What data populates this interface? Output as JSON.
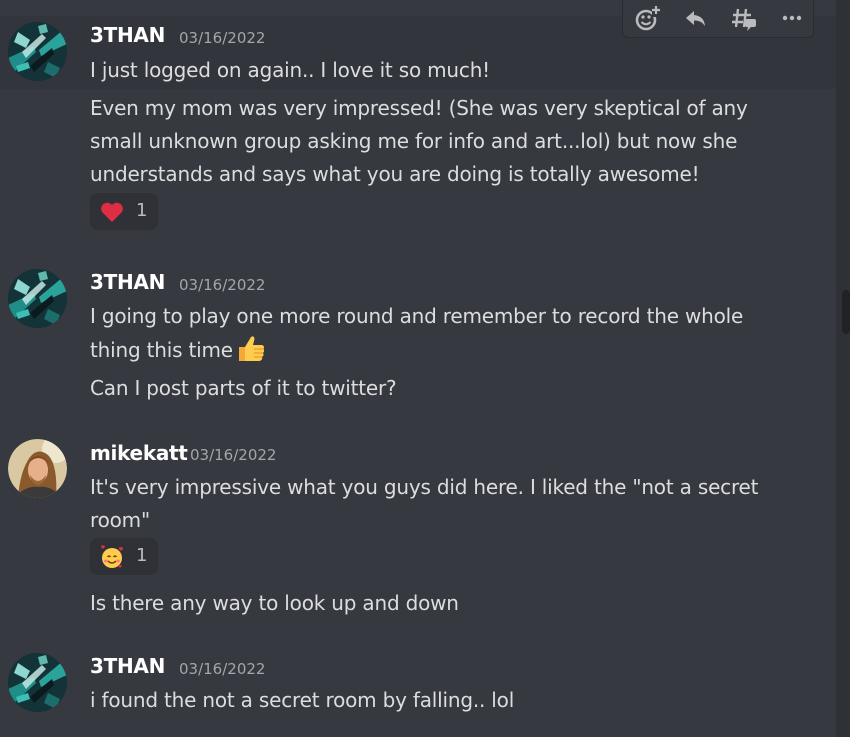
{
  "toolbar": {
    "icons": [
      "add-reaction-icon",
      "reply-icon",
      "create-thread-icon",
      "more-options-icon"
    ]
  },
  "messages": [
    {
      "author": "3THAN",
      "timestamp": "03/16/2022",
      "lines": [
        "I just logged on again.. I love it so much!",
        "Even my mom was very impressed! (She was very skeptical of any small unknown group asking me for info and art...lol) but now she understands and says what you are doing is totally awesome!"
      ],
      "reaction": {
        "emoji": "heart-icon",
        "count": "1"
      }
    },
    {
      "author": "3THAN",
      "timestamp": "03/16/2022",
      "lines": [
        "I going to play one more round and remember to record the whole thing this time",
        "Can I post parts of it to twitter?"
      ],
      "inline_emoji": "thumbs-up-icon"
    },
    {
      "author": "mikekatt",
      "timestamp": "03/16/2022",
      "lines": [
        "It's very impressive what you guys did here. I liked the \"not a secret room\"",
        "Is there any way to look up and down"
      ],
      "reaction": {
        "emoji": "smiling-face-with-hearts-icon",
        "count": "1"
      }
    },
    {
      "author": "3THAN",
      "timestamp": "03/16/2022",
      "lines": [
        "i found the not a secret room by falling.. lol"
      ]
    }
  ],
  "colors": {
    "background": "#36393f",
    "username": "#ffffff",
    "timestamp": "#a3a6aa",
    "message_text": "#dcddde",
    "reaction_bg": "#2f3136",
    "heart": "#dd2e44"
  }
}
